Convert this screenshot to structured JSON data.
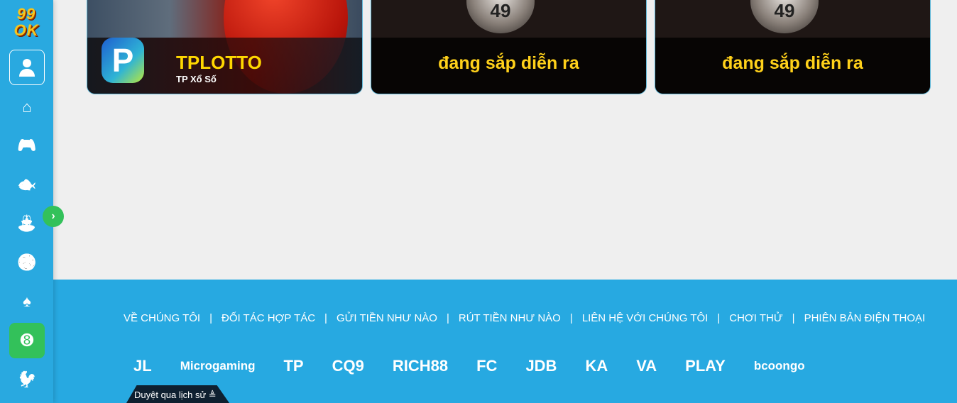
{
  "brand": {
    "logo_text": "99OK"
  },
  "sidebar": {
    "items": [
      {
        "name": "home",
        "icon": "⌂"
      },
      {
        "name": "games",
        "icon": "🎮"
      },
      {
        "name": "fishing",
        "icon": "🐟"
      },
      {
        "name": "casino",
        "icon": "⛲"
      },
      {
        "name": "sports",
        "icon": "⚽"
      },
      {
        "name": "cards",
        "icon": "♠"
      },
      {
        "name": "lottery",
        "icon": "➑",
        "active": true
      },
      {
        "name": "cockfight",
        "icon": "🐓"
      }
    ],
    "active_color": "#33c15a"
  },
  "cards": [
    {
      "title": "TPLOTTO",
      "subtitle": "TP Xổ Số"
    },
    {
      "ball": "49",
      "title": "đang sắp diễn ra"
    },
    {
      "ball": "49",
      "title": "đang sắp diễn ra"
    }
  ],
  "footer": {
    "links": [
      "VỀ CHÚNG TÔI",
      "ĐỐI TÁC HỢP TÁC",
      "GỬI TIỀN NHƯ NÀO",
      "RÚT TIỀN NHƯ NÀO",
      "LIÊN HỆ VỚI CHÚNG TÔI",
      "CHƠI THỬ",
      "PHIÊN BẢN ĐIỆN THOẠI"
    ],
    "providers": [
      "JL",
      "Microgaming",
      "TP",
      "CQ9",
      "RICH88",
      "FC",
      "JDB",
      "KA",
      "VA",
      "PLAY",
      "bcoongo"
    ],
    "history_label": "Duyệt qua lịch sử ≜"
  },
  "colors": {
    "sidebar": "#29a9e0",
    "footer": "#27a9e1",
    "card_title": "#ffd11a"
  }
}
